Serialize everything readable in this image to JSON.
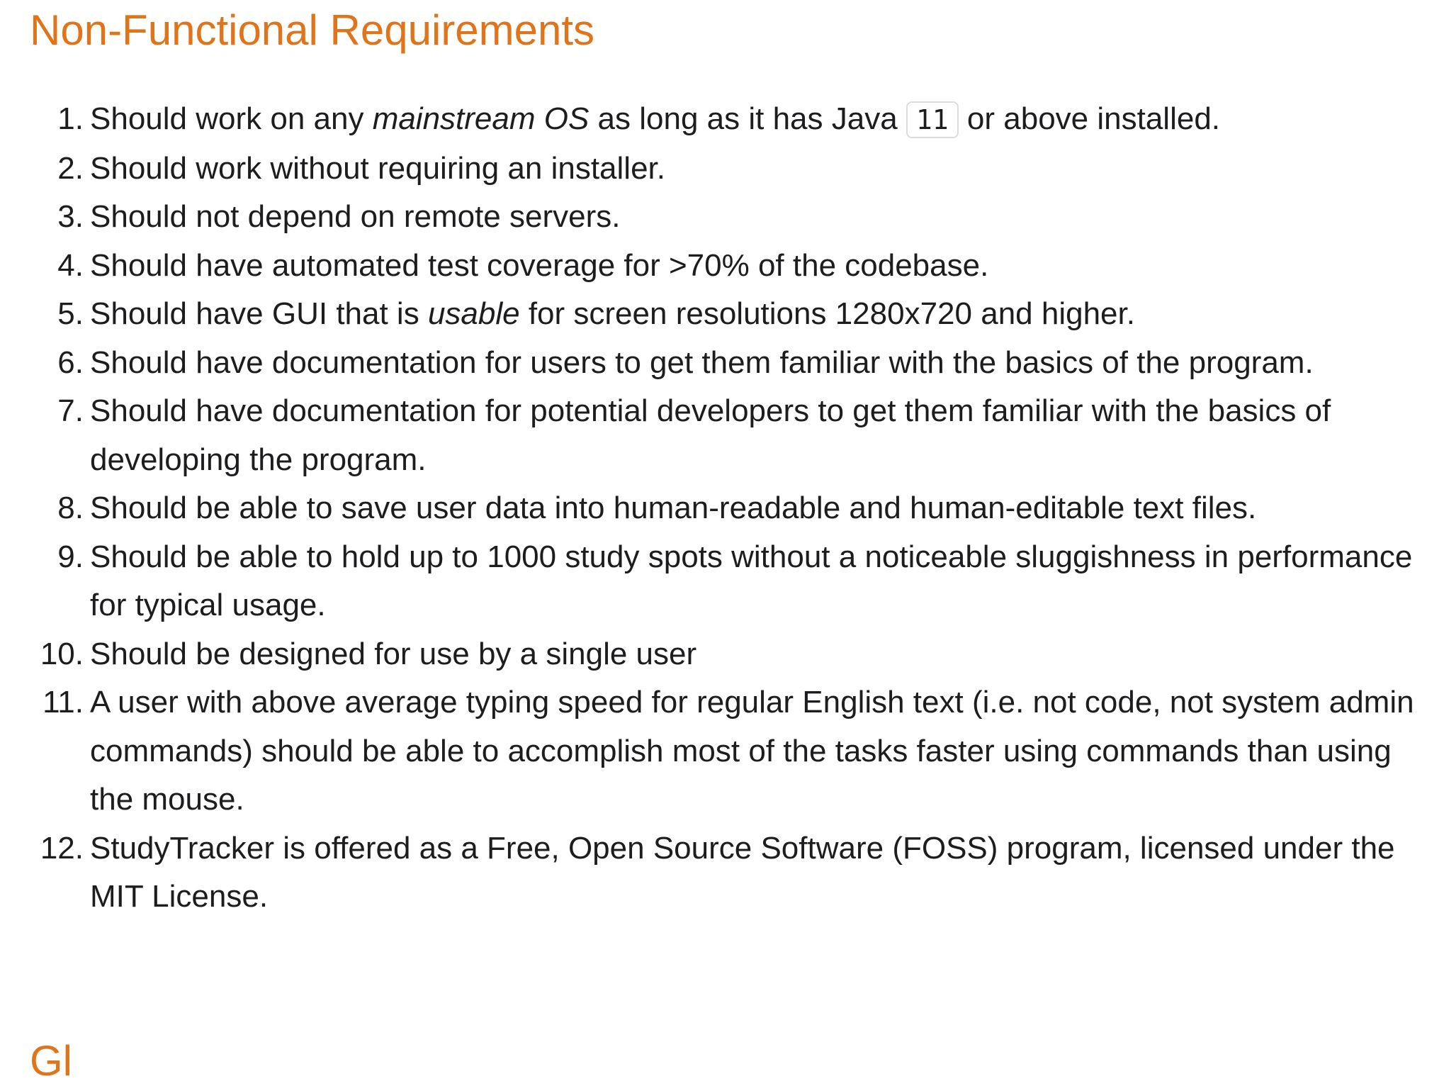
{
  "heading": "Non-Functional Requirements",
  "next_heading": "Gl",
  "requirements": [
    {
      "num": "1.",
      "pre": "Should work on any ",
      "em": "mainstream OS",
      "mid": " as long as it has Java ",
      "code": "11",
      "post": " or above installed."
    },
    {
      "num": "2.",
      "text": "Should work without requiring an installer."
    },
    {
      "num": "3.",
      "text": "Should not depend on remote servers."
    },
    {
      "num": "4.",
      "text": "Should have automated test coverage for >70% of the codebase."
    },
    {
      "num": "5.",
      "pre": "Should have GUI that is ",
      "em": "usable",
      "post": " for screen resolutions 1280x720 and higher."
    },
    {
      "num": "6.",
      "text": "Should have documentation for users to get them familiar with the basics of the program."
    },
    {
      "num": "7.",
      "text": "Should have documentation for potential developers to get them familiar with the basics of developing the program."
    },
    {
      "num": "8.",
      "text": "Should be able to save user data into human-readable and human-editable text files."
    },
    {
      "num": "9.",
      "text": "Should be able to hold up to 1000 study spots without a noticeable sluggishness in performance for typical usage."
    },
    {
      "num": "10.",
      "text": "Should be designed for use by a single user"
    },
    {
      "num": "11.",
      "text": "A user with above average typing speed for regular English text (i.e. not code, not system admin commands) should be able to accomplish most of the tasks faster using commands than using the mouse."
    },
    {
      "num": "12.",
      "text": "StudyTracker is offered as a Free, Open Source Software (FOSS) program, licensed under the MIT License."
    }
  ]
}
